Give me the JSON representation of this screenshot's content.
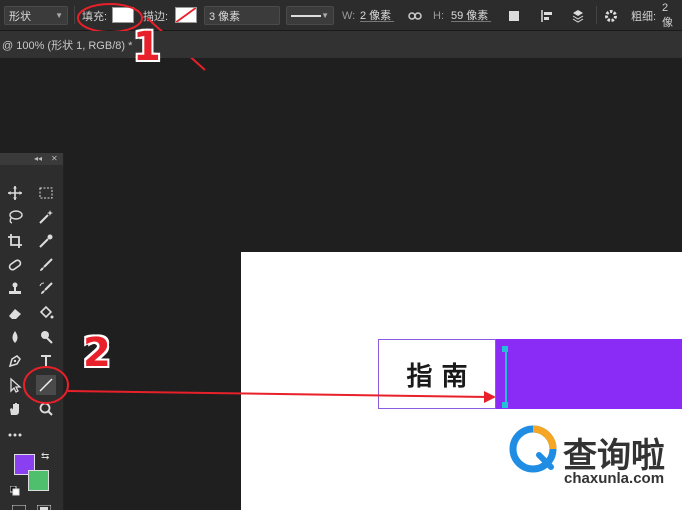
{
  "options_bar": {
    "mode": "形状",
    "fill_label": "填充:",
    "stroke_label": "描边:",
    "stroke_width": "3 像素",
    "w_label": "W:",
    "w_value": "2 像素",
    "h_label": "H:",
    "h_value": "59 像素",
    "weight_label": "粗细:",
    "weight_value": "2 像"
  },
  "document_tab": {
    "title": "@ 100% (形状 1, RGB/8) *"
  },
  "toolbox": {
    "foreground_color": "#8a3ff0",
    "background_color": "#4fbf6d"
  },
  "canvas": {
    "label_text": "指 南",
    "bar_color": "#8a2cf5"
  },
  "annotations": {
    "step1": "1",
    "step2": "2",
    "color": "#e8202a"
  },
  "watermark": {
    "brand": "查询啦",
    "domain": "chaxunla.com"
  }
}
